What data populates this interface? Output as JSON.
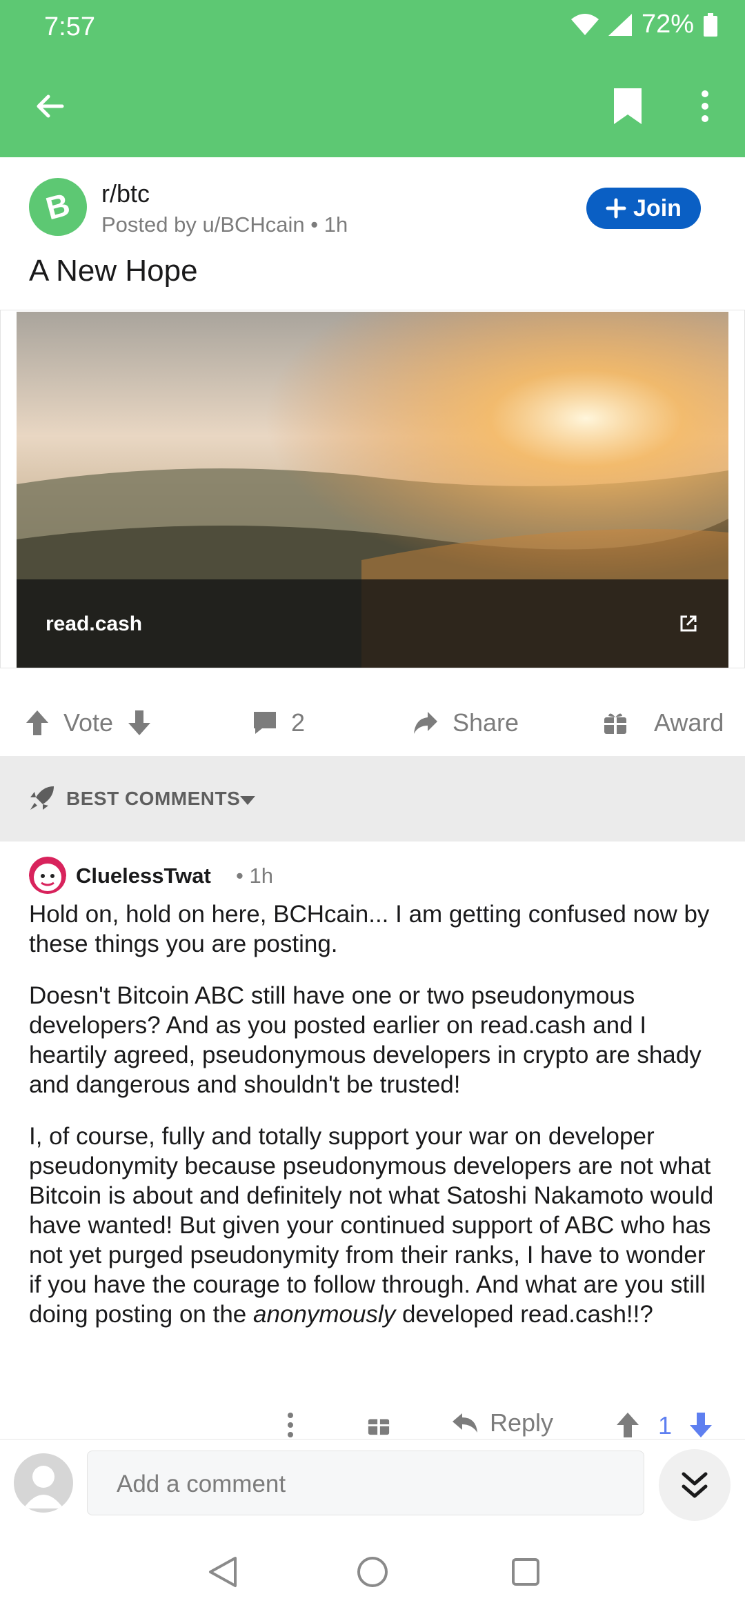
{
  "status": {
    "time": "7:57",
    "battery": "72%"
  },
  "colors": {
    "brand_green": "#5dc873",
    "join_blue": "#0a5fc4",
    "vote_blue": "#5e7ff0"
  },
  "post": {
    "subreddit": "r/btc",
    "posted_by": "Posted by u/BCHcain • 1h",
    "join_label": "Join",
    "title": "A New Hope",
    "link_domain": "read.cash"
  },
  "actions": {
    "vote_label": "Vote",
    "comment_count": "2",
    "share_label": "Share",
    "award_label": "Award"
  },
  "sort": {
    "label": "BEST COMMENTS"
  },
  "comment": {
    "author": "CluelessTwat",
    "age": "• 1h",
    "para1": "Hold on, hold on here, BCHcain... I am getting confused now by these things you are posting.",
    "para2": "Doesn't Bitcoin ABC still have one or two pseudonymous developers? And as you posted earlier on read.cash and I heartily agreed, pseudonymous developers in crypto are shady and dangerous and shouldn't be trusted!",
    "para3_start": "I, of course, fully and totally support your war on developer pseudonymity because pseudonymous developers are not what Bitcoin is about and definitely not what Satoshi Nakamoto would have wanted! But given your continued support of ABC who has not yet purged pseudonymity from their ranks, I have to wonder if you have the courage to follow through. And what are you still doing posting on the ",
    "para3_emph": "anonymously",
    "para3_end": " developed read.cash!!?",
    "reply_label": "Reply",
    "score": "1"
  },
  "composer": {
    "placeholder": "Add a comment"
  }
}
